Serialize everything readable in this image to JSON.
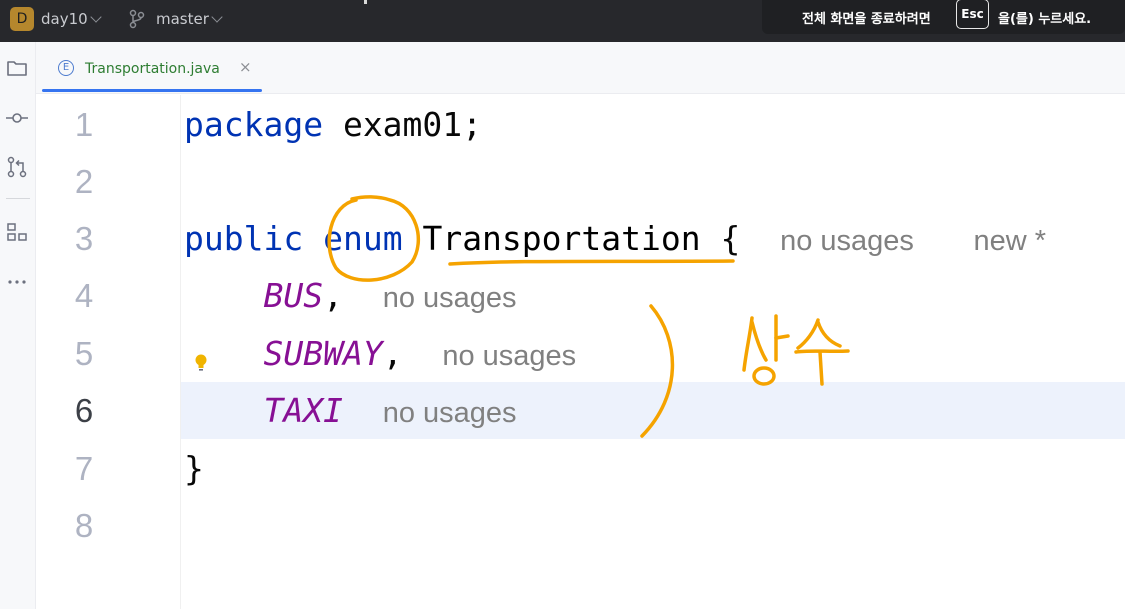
{
  "titlebar": {
    "project_initial": "D",
    "project_name": "day10",
    "branch_name": "master"
  },
  "fullscreen_notice": {
    "text_before": "전체 화면을 종료하려면",
    "key": "Esc",
    "text_after": "을(를) 누르세요."
  },
  "tab": {
    "icon_letter": "E",
    "label": "Transportation.java",
    "close": "×"
  },
  "editor": {
    "line_numbers": [
      "1",
      "2",
      "3",
      "4",
      "5",
      "6",
      "7",
      "8"
    ],
    "current_line": 6,
    "line1": {
      "keyword": "package",
      "rest": " exam01;"
    },
    "line3": {
      "keyword1": "public",
      "keyword2": "enum",
      "type_name": "Transportation",
      "brace": " {",
      "hint1": "no usages",
      "hint2": "new *"
    },
    "line4": {
      "constant": "BUS",
      "punct": ",",
      "hint": "no usages"
    },
    "line5": {
      "constant": "SUBWAY",
      "punct": ",",
      "hint": "no usages"
    },
    "line6": {
      "constant": "TAXI",
      "hint": "no usages"
    },
    "line7": {
      "brace": "}"
    }
  },
  "annotation": {
    "handwritten_text": "상수",
    "color": "#f5a300"
  },
  "colors": {
    "keyword": "#0033b3",
    "enum_constant": "#871094",
    "hint": "#808080",
    "tab_label": "#2e7d32",
    "tab_underline": "#3574f0",
    "current_line_bg": "#edf2fc"
  },
  "icons": [
    "folder-icon",
    "commit-icon",
    "pull-request-icon",
    "structure-icon",
    "more-icon",
    "lightbulb-icon",
    "branch-icon"
  ]
}
